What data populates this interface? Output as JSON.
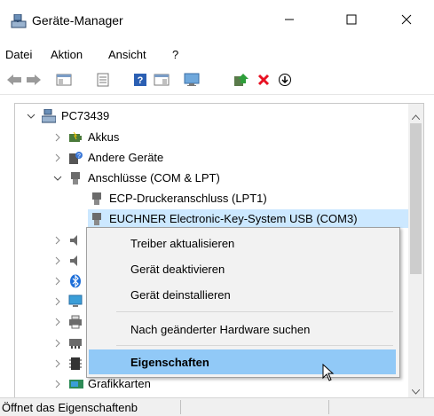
{
  "window": {
    "title": "Geräte-Manager",
    "app_icon": "device-manager-icon",
    "minimize_icon": "minimize-icon",
    "maximize_icon": "maximize-icon",
    "close_icon": "close-icon"
  },
  "menubar": {
    "items": [
      "Datei",
      "Aktion",
      "Ansicht",
      "?"
    ]
  },
  "toolbar": {
    "buttons": [
      "back-arrow-icon",
      "forward-arrow-icon",
      "show-hide-console-tree-icon",
      "properties-icon",
      "help-icon",
      "view-icon",
      "monitor-icon",
      "update-driver-icon",
      "uninstall-icon",
      "download-icon"
    ]
  },
  "tree": {
    "root": "PC73439",
    "items": [
      {
        "label": "Akkus",
        "icon": "battery-icon"
      },
      {
        "label": "Andere Geräte",
        "icon": "unknown-device-icon"
      },
      {
        "label": "Anschlüsse (COM & LPT)",
        "icon": "port-icon"
      },
      {
        "label": "ECP-Druckeranschluss (LPT1)",
        "icon": "port-icon"
      },
      {
        "label": "EUCHNER Electronic-Key-System USB (COM3)",
        "icon": "port-icon"
      },
      {
        "label": "Grafikkarten",
        "icon": "display-adapter-icon"
      }
    ]
  },
  "context_menu": {
    "items": [
      "Treiber aktualisieren",
      "Gerät deaktivieren",
      "Gerät deinstallieren",
      "Nach geänderter Hardware suchen",
      "Eigenschaften"
    ]
  },
  "statusbar": {
    "text": "Öffnet das Eigenschaftenb"
  },
  "colors": {
    "selection": "#cce8ff",
    "menu_highlight": "#91c9f7",
    "uninstall_red": "#e81123"
  }
}
